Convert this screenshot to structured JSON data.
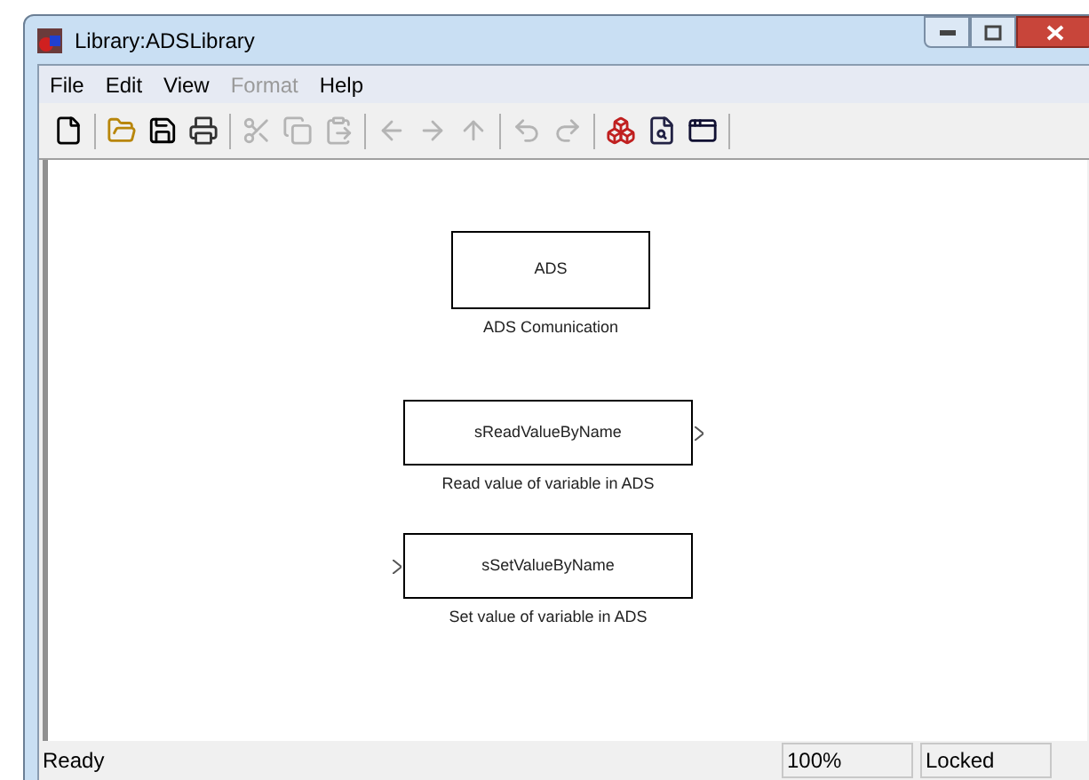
{
  "window": {
    "title": "Library:ADSLibrary"
  },
  "menu": [
    {
      "label": "File",
      "disabled": false
    },
    {
      "label": "Edit",
      "disabled": false
    },
    {
      "label": "View",
      "disabled": false
    },
    {
      "label": "Format",
      "disabled": true
    },
    {
      "label": "Help",
      "disabled": false
    }
  ],
  "toolbar": [
    {
      "kind": "new",
      "disabled": false
    },
    {
      "kind": "separator"
    },
    {
      "kind": "open",
      "disabled": false
    },
    {
      "kind": "save",
      "disabled": false
    },
    {
      "kind": "print",
      "disabled": false
    },
    {
      "kind": "separator"
    },
    {
      "kind": "cut",
      "disabled": true
    },
    {
      "kind": "copy",
      "disabled": true
    },
    {
      "kind": "paste",
      "disabled": true
    },
    {
      "kind": "separator"
    },
    {
      "kind": "back",
      "disabled": true
    },
    {
      "kind": "forward",
      "disabled": true
    },
    {
      "kind": "up",
      "disabled": true
    },
    {
      "kind": "separator"
    },
    {
      "kind": "undo",
      "disabled": true
    },
    {
      "kind": "redo",
      "disabled": true
    },
    {
      "kind": "separator"
    },
    {
      "kind": "library",
      "disabled": false
    },
    {
      "kind": "explorer",
      "disabled": false
    },
    {
      "kind": "window",
      "disabled": false
    },
    {
      "kind": "separator"
    }
  ],
  "blocks": [
    {
      "text": "ADS",
      "caption": "ADS Comunication",
      "input_port": false,
      "output_port": false
    },
    {
      "text": "sReadValueByName",
      "caption": "Read value of variable in ADS",
      "input_port": false,
      "output_port": true
    },
    {
      "text": "sSetValueByName",
      "caption": "Set value of variable in ADS",
      "input_port": true,
      "output_port": false
    }
  ],
  "status_bar": {
    "message": "Ready",
    "zoom": "100%",
    "lock": "Locked"
  }
}
